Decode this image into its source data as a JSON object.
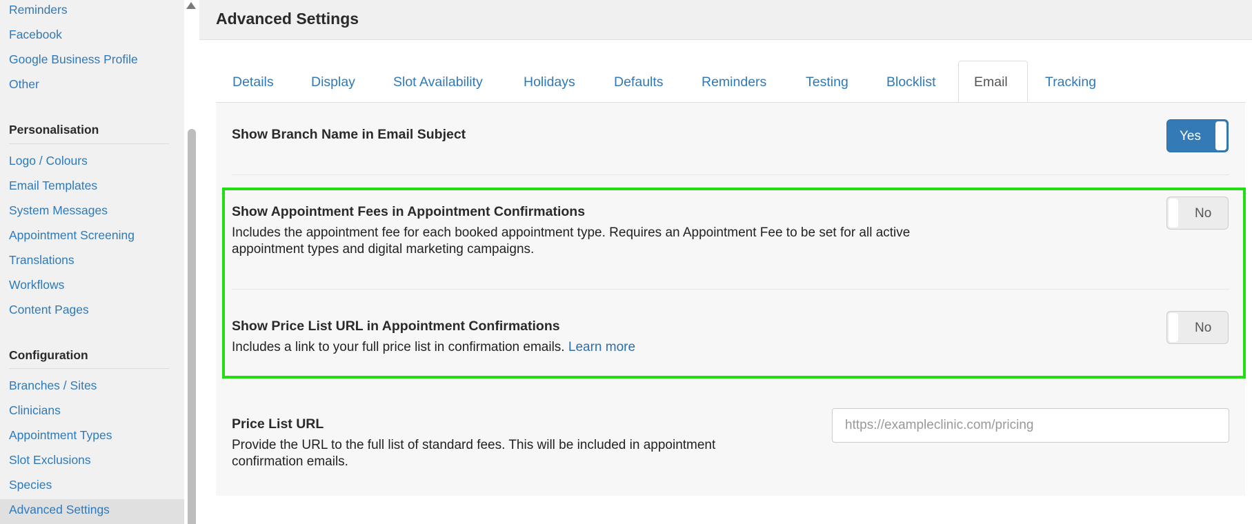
{
  "sidebar": {
    "top_links": [
      "Reminders",
      "Facebook",
      "Google Business Profile",
      "Other"
    ],
    "personalisation": {
      "heading": "Personalisation",
      "items": [
        "Logo / Colours",
        "Email Templates",
        "System Messages",
        "Appointment Screening",
        "Translations",
        "Workflows",
        "Content Pages"
      ]
    },
    "configuration": {
      "heading": "Configuration",
      "items": [
        "Branches / Sites",
        "Clinicians",
        "Appointment Types",
        "Slot Exclusions",
        "Species",
        "Advanced Settings"
      ]
    }
  },
  "header": {
    "title": "Advanced Settings"
  },
  "tabs": [
    {
      "label": "Details"
    },
    {
      "label": "Display"
    },
    {
      "label": "Slot Availability"
    },
    {
      "label": "Holidays"
    },
    {
      "label": "Defaults"
    },
    {
      "label": "Reminders"
    },
    {
      "label": "Testing"
    },
    {
      "label": "Blocklist"
    },
    {
      "label": "Email"
    },
    {
      "label": "Tracking"
    }
  ],
  "settings": {
    "branch_name": {
      "title": "Show Branch Name in Email Subject",
      "toggle": "Yes"
    },
    "appointment_fees": {
      "title": "Show Appointment Fees in Appointment Confirmations",
      "desc_line1": "Includes the appointment fee for each booked appointment type. Requires an Appointment Fee to be set for all active",
      "desc_line2": "appointment types and digital marketing campaigns.",
      "toggle": "No"
    },
    "price_list_url_toggle": {
      "title": "Show Price List URL in Appointment Confirmations",
      "desc": "Includes a link to your full price list in confirmation emails.",
      "link": "Learn more",
      "toggle": "No"
    },
    "price_list_url": {
      "title": "Price List URL",
      "desc_line1": "Provide the URL to the full list of standard fees. This will be included in appointment",
      "desc_line2": "confirmation emails.",
      "placeholder": "https://exampleclinic.com/pricing"
    }
  },
  "colors": {
    "accent": "#337ab7",
    "link": "#2f79b9",
    "highlight": "#22dd11"
  }
}
